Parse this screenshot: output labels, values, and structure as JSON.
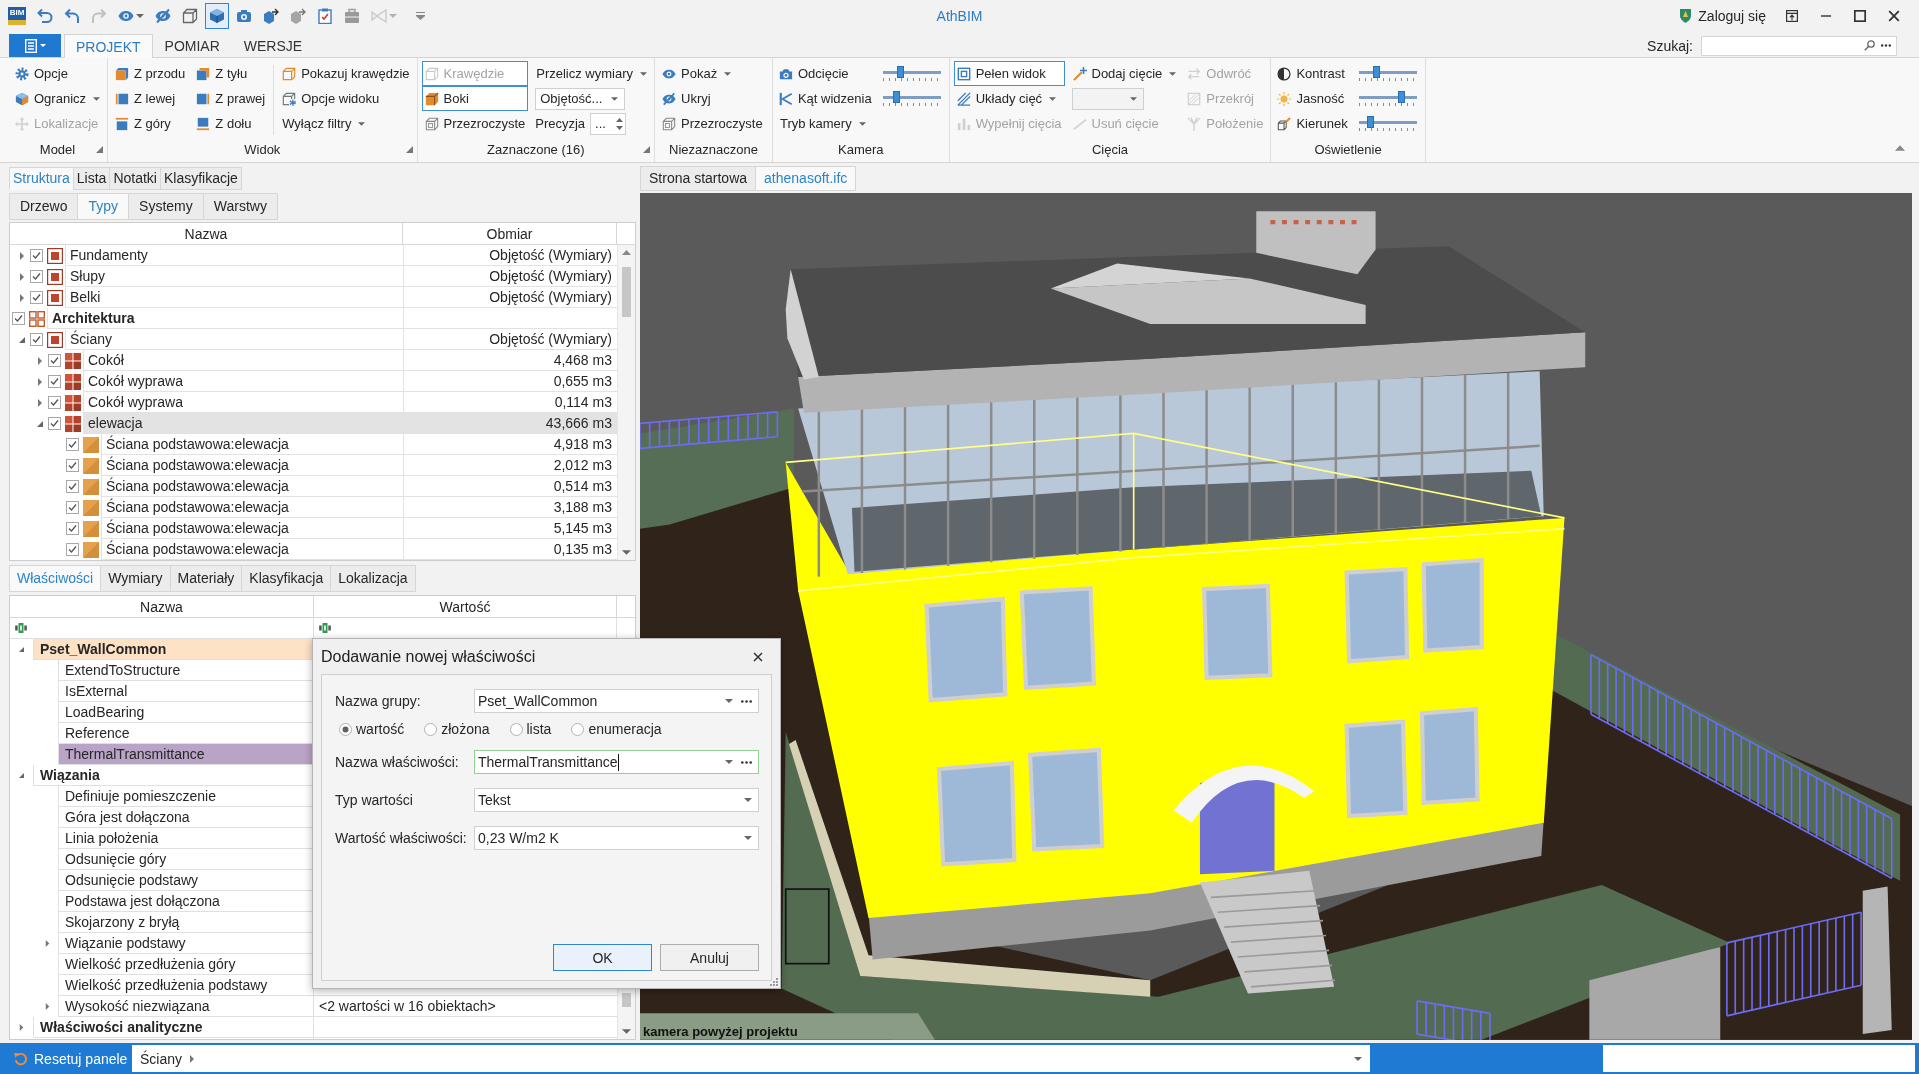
{
  "window": {
    "app_logo": "BIM",
    "title": "AthBIM",
    "login": "Zaloguj się"
  },
  "quick_access": [
    {
      "kind": "button",
      "pressed": false,
      "disabled": false
    },
    {
      "kind": "button",
      "pressed": false,
      "disabled": false
    },
    {
      "kind": "button",
      "pressed": false,
      "disabled": true
    },
    {
      "kind": "dropdown",
      "pressed": false,
      "disabled": false
    },
    {
      "kind": "button",
      "pressed": false,
      "disabled": false
    },
    {
      "kind": "button",
      "pressed": false,
      "disabled": false
    },
    {
      "kind": "button",
      "pressed": true,
      "disabled": false
    },
    {
      "kind": "button",
      "pressed": false,
      "disabled": false
    },
    {
      "kind": "button",
      "pressed": false,
      "disabled": false
    },
    {
      "kind": "button",
      "pressed": false,
      "disabled": false
    },
    {
      "kind": "button",
      "pressed": false,
      "disabled": false
    },
    {
      "kind": "button",
      "pressed": false,
      "disabled": false
    },
    {
      "kind": "dropdown",
      "pressed": false,
      "disabled": true
    }
  ],
  "ribbon": {
    "tabs": [
      {
        "label": "PROJEKT",
        "selected": true
      },
      {
        "label": "POMIAR",
        "selected": false
      },
      {
        "label": "WERSJE",
        "selected": false
      }
    ],
    "search": {
      "label": "Szukaj:"
    },
    "groups": [
      {
        "title": "Model",
        "launcher": true,
        "columns": [
          {
            "items": [
              {
                "kind": "button",
                "label": "Opcje",
                "pressed": false,
                "disabled": false
              },
              {
                "kind": "dropdown",
                "label": "Ogranicz",
                "pressed": false,
                "disabled": false
              },
              {
                "kind": "button",
                "label": "Lokalizacje",
                "pressed": false,
                "disabled": true
              }
            ]
          }
        ]
      },
      {
        "title": "Widok",
        "launcher": true,
        "columns": [
          {
            "items": [
              {
                "kind": "button",
                "label": "Z przodu",
                "pressed": false,
                "disabled": false
              },
              {
                "kind": "button",
                "label": "Z lewej",
                "pressed": false,
                "disabled": false
              },
              {
                "kind": "button",
                "label": "Z góry",
                "pressed": false,
                "disabled": false
              }
            ]
          },
          {
            "items": [
              {
                "kind": "button",
                "label": "Z tyłu",
                "pressed": false,
                "disabled": false
              },
              {
                "kind": "button",
                "label": "Z prawej",
                "pressed": false,
                "disabled": false
              },
              {
                "kind": "button",
                "label": "Z dołu",
                "pressed": false,
                "disabled": false
              }
            ]
          },
          {
            "divider": true,
            "items": [
              {
                "kind": "button",
                "label": "Pokazuj krawędzie",
                "pressed": false,
                "disabled": false
              },
              {
                "kind": "button",
                "label": "Opcje widoku",
                "pressed": false,
                "disabled": false
              },
              {
                "kind": "menu",
                "label": "Wyłącz filtry",
                "pressed": false,
                "disabled": false
              }
            ]
          }
        ]
      },
      {
        "title": "Zaznaczone (16)",
        "launcher": true,
        "columns": [
          {
            "items": [
              {
                "kind": "button",
                "label": "Krawędzie",
                "pressed": true,
                "disabled": true
              },
              {
                "kind": "button",
                "label": "Boki",
                "pressed": true,
                "disabled": false
              },
              {
                "kind": "button",
                "label": "Przezroczyste",
                "pressed": false,
                "disabled": false
              }
            ]
          },
          {
            "items": [
              {
                "kind": "menu",
                "label": "Przelicz wymiary",
                "pressed": false,
                "disabled": false
              },
              {
                "kind": "combo",
                "value": "Objętość...",
                "disabled": false
              },
              {
                "kind": "spin",
                "label": "Precyzja",
                "value": "..."
              }
            ]
          }
        ]
      },
      {
        "title": "Niezaznaczone",
        "launcher": false,
        "columns": [
          {
            "items": [
              {
                "kind": "dropdown",
                "label": "Pokaż",
                "pressed": false,
                "disabled": false
              },
              {
                "kind": "button",
                "label": "Ukryj",
                "pressed": false,
                "disabled": false
              },
              {
                "kind": "button",
                "label": "Przezroczyste",
                "pressed": false,
                "disabled": false
              }
            ]
          }
        ]
      },
      {
        "title": "Kamera",
        "launcher": false,
        "columns": [
          {
            "items": [
              {
                "kind": "label",
                "label": "Odcięcie"
              },
              {
                "kind": "label",
                "label": "Kąt widzenia"
              },
              {
                "kind": "menu",
                "label": "Tryb kamery",
                "pressed": false,
                "disabled": false
              }
            ]
          },
          {
            "items": [
              {
                "kind": "slider",
                "level": 0.29
              },
              {
                "kind": "slider",
                "level": 0.2
              }
            ]
          }
        ]
      },
      {
        "title": "Cięcia",
        "launcher": false,
        "columns": [
          {
            "items": [
              {
                "kind": "button",
                "label": "Pełen widok",
                "pressed": true,
                "disabled": false
              },
              {
                "kind": "dropdown",
                "label": "Układy cięć",
                "pressed": false,
                "disabled": false
              },
              {
                "kind": "button",
                "label": "Wypełnij cięcia",
                "pressed": false,
                "disabled": true
              }
            ]
          },
          {
            "items": [
              {
                "kind": "dropdown",
                "label": "Dodaj cięcie",
                "pressed": false,
                "disabled": false
              },
              {
                "kind": "combo",
                "disabled": true
              },
              {
                "kind": "button",
                "label": "Usuń cięcie",
                "pressed": false,
                "disabled": true
              }
            ]
          },
          {
            "items": [
              {
                "kind": "button",
                "label": "Odwróć",
                "pressed": false,
                "disabled": true
              },
              {
                "kind": "button",
                "label": "Przekrój",
                "pressed": false,
                "disabled": true
              },
              {
                "kind": "button",
                "label": "Położenie",
                "pressed": false,
                "disabled": true
              }
            ]
          }
        ]
      },
      {
        "title": "Oświetlenie",
        "launcher": false,
        "columns": [
          {
            "items": [
              {
                "kind": "label",
                "label": "Kontrast"
              },
              {
                "kind": "label",
                "label": "Jasność"
              },
              {
                "kind": "label",
                "label": "Kierunek"
              }
            ]
          },
          {
            "items": [
              {
                "kind": "slider",
                "level": 0.28
              },
              {
                "kind": "slider",
                "level": 0.76
              },
              {
                "kind": "slider",
                "level": 0.16
              }
            ]
          }
        ]
      }
    ]
  },
  "structure_panel": {
    "tabs": [
      {
        "label": "Struktura",
        "selected": true
      },
      {
        "label": "Lista",
        "selected": false
      },
      {
        "label": "Notatki",
        "selected": false
      },
      {
        "label": "Klasyfikacje",
        "selected": false
      }
    ],
    "view_tabs": [
      {
        "label": "Drzewo",
        "selected": false
      },
      {
        "label": "Typy",
        "selected": true
      },
      {
        "label": "Systemy",
        "selected": false
      },
      {
        "label": "Warstwy",
        "selected": false
      }
    ],
    "columns": [
      "Nazwa",
      "Obmiar"
    ],
    "rows": [
      {
        "kind": "category",
        "name": "Fundamenty",
        "measure": "Objętość (Wymiary)",
        "checked": true,
        "expanded": false,
        "selected": false
      },
      {
        "kind": "category",
        "name": "Słupy",
        "measure": "Objętość (Wymiary)",
        "checked": true,
        "expanded": false,
        "selected": false
      },
      {
        "kind": "category",
        "name": "Belki",
        "measure": "Objętość (Wymiary)",
        "checked": true,
        "expanded": false,
        "selected": false
      },
      {
        "kind": "group",
        "name": "Architektura",
        "checked": true,
        "selected": false,
        "children": [
          {
            "kind": "category",
            "name": "Ściany",
            "measure": "Objętość (Wymiary)",
            "checked": true,
            "expanded": true,
            "selected": false,
            "children": [
              {
                "kind": "type",
                "name": "Cokół",
                "measure": "4,468 m3",
                "checked": true,
                "expanded": false,
                "selected": false
              },
              {
                "kind": "type",
                "name": "Cokół wyprawa",
                "measure": "0,655 m3",
                "checked": true,
                "expanded": false,
                "selected": false
              },
              {
                "kind": "type",
                "name": "Cokół wyprawa",
                "measure": "0,114 m3",
                "checked": true,
                "expanded": false,
                "selected": false
              },
              {
                "kind": "type",
                "name": "elewacja",
                "measure": "43,666 m3",
                "checked": true,
                "expanded": true,
                "selected": true,
                "children": [
                  {
                    "kind": "element",
                    "name": "Ściana podstawowa:elewacja",
                    "measure": "4,918 m3",
                    "checked": true,
                    "selected": false
                  },
                  {
                    "kind": "element",
                    "name": "Ściana podstawowa:elewacja",
                    "measure": "2,012 m3",
                    "checked": true,
                    "selected": false
                  },
                  {
                    "kind": "element",
                    "name": "Ściana podstawowa:elewacja",
                    "measure": "0,514 m3",
                    "checked": true,
                    "selected": false
                  },
                  {
                    "kind": "element",
                    "name": "Ściana podstawowa:elewacja",
                    "measure": "3,188 m3",
                    "checked": true,
                    "selected": false
                  },
                  {
                    "kind": "element",
                    "name": "Ściana podstawowa:elewacja",
                    "measure": "5,145 m3",
                    "checked": true,
                    "selected": false
                  },
                  {
                    "kind": "element",
                    "name": "Ściana podstawowa:elewacja",
                    "measure": "0,135 m3",
                    "checked": true,
                    "selected": false
                  }
                ]
              }
            ]
          }
        ]
      }
    ]
  },
  "properties_panel": {
    "tabs": [
      {
        "label": "Właściwości",
        "selected": true
      },
      {
        "label": "Wymiary",
        "selected": false
      },
      {
        "label": "Materiały",
        "selected": false
      },
      {
        "label": "Klasyfikacja",
        "selected": false
      },
      {
        "label": "Lokalizacja",
        "selected": false
      }
    ],
    "columns": [
      "Nazwa",
      "Wartość"
    ],
    "groups": [
      {
        "name": "Pset_WallCommon",
        "expanded": true,
        "selected": true,
        "rows": [
          {
            "name": "ExtendToStructure",
            "selected": false
          },
          {
            "name": "IsExternal",
            "selected": false
          },
          {
            "name": "LoadBearing",
            "selected": false
          },
          {
            "name": "Reference",
            "selected": false
          },
          {
            "name": "ThermalTransmittance",
            "selected": true
          }
        ]
      },
      {
        "name": "Wiązania",
        "expanded": true,
        "selected": false,
        "rows": [
          {
            "name": "Definiuje pomieszczenie",
            "selected": false
          },
          {
            "name": "Góra jest dołączona",
            "selected": false
          },
          {
            "name": "Linia położenia",
            "selected": false
          },
          {
            "name": "Odsunięcie góry",
            "selected": false
          },
          {
            "name": "Odsunięcie podstawy",
            "selected": false
          },
          {
            "name": "Podstawa jest dołączona",
            "selected": false
          },
          {
            "name": "Skojarzony z bryłą",
            "selected": false
          },
          {
            "name": "Wiązanie podstawy",
            "expanded": false,
            "selected": false
          },
          {
            "name": "Wielkość przedłużenia góry",
            "selected": false
          },
          {
            "name": "Wielkość przedłużenia podstawy",
            "selected": false
          },
          {
            "name": "Wysokość niezwiązana",
            "expanded": false,
            "selected": false,
            "value": "<2 wartości w 16 obiektach>"
          }
        ]
      },
      {
        "name": "Właściwości analityczne",
        "expanded": false,
        "selected": false
      }
    ]
  },
  "viewport": {
    "tabs": [
      {
        "label": "Strona startowa",
        "selected": false
      },
      {
        "label": "athenasoft.ifc",
        "selected": true
      }
    ],
    "camera_label": "kamera powyżej projektu"
  },
  "dialog": {
    "title": "Dodawanie nowej właściwości",
    "fields": [
      {
        "kind": "combo-browse",
        "label": "Nazwa grupy:",
        "value": "Pset_WallCommon",
        "focused": false
      },
      {
        "kind": "radios",
        "options": [
          {
            "label": "wartość",
            "selected": true
          },
          {
            "label": "złożona",
            "selected": false
          },
          {
            "label": "lista",
            "selected": false
          },
          {
            "label": "enumeracja",
            "selected": false
          }
        ]
      },
      {
        "kind": "combo-browse",
        "label": "Nazwa właściwości:",
        "value": "ThermalTransmittance",
        "focused": true
      },
      {
        "kind": "combo",
        "label": "Typ wartości",
        "value": "Tekst",
        "focused": false
      },
      {
        "kind": "combo",
        "label": "Wartość właściwości:",
        "value": "0,23 W/m2 K",
        "focused": false
      }
    ],
    "buttons": [
      {
        "label": "OK",
        "default": true
      },
      {
        "label": "Anuluj",
        "default": false
      }
    ]
  },
  "status_bar": {
    "reset_button": "Resetuj panele",
    "breadcrumb": [
      "Ściany"
    ]
  }
}
